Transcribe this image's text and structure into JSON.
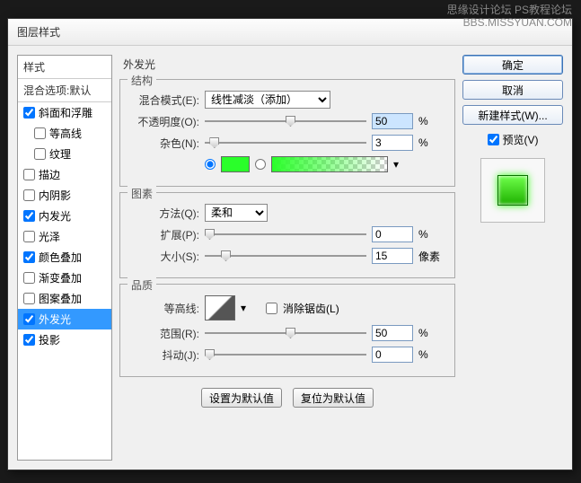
{
  "watermark": {
    "line1": "思缘设计论坛  PS教程论坛",
    "line2": "BBS.MISSYUAN.COM"
  },
  "dialog": {
    "title": "图层样式"
  },
  "styles": {
    "header": "样式",
    "blend": "混合选项:默认",
    "items": [
      {
        "label": "斜面和浮雕",
        "checked": true,
        "indent": false
      },
      {
        "label": "等高线",
        "checked": false,
        "indent": true
      },
      {
        "label": "纹理",
        "checked": false,
        "indent": true
      },
      {
        "label": "描边",
        "checked": false,
        "indent": false
      },
      {
        "label": "内阴影",
        "checked": false,
        "indent": false
      },
      {
        "label": "内发光",
        "checked": true,
        "indent": false
      },
      {
        "label": "光泽",
        "checked": false,
        "indent": false
      },
      {
        "label": "颜色叠加",
        "checked": true,
        "indent": false
      },
      {
        "label": "渐变叠加",
        "checked": false,
        "indent": false
      },
      {
        "label": "图案叠加",
        "checked": false,
        "indent": false
      },
      {
        "label": "外发光",
        "checked": true,
        "indent": false,
        "selected": true
      },
      {
        "label": "投影",
        "checked": true,
        "indent": false
      }
    ]
  },
  "panel": {
    "title": "外发光",
    "struct": {
      "legend": "结构",
      "blend_label": "混合模式(E):",
      "blend_value": "线性减淡（添加）",
      "opacity_label": "不透明度(O):",
      "opacity_value": "50",
      "opacity_unit": "%",
      "noise_label": "杂色(N):",
      "noise_value": "3",
      "noise_unit": "%",
      "color": "#2aff2a"
    },
    "elem": {
      "legend": "图素",
      "tech_label": "方法(Q):",
      "tech_value": "柔和",
      "spread_label": "扩展(P):",
      "spread_value": "0",
      "spread_unit": "%",
      "size_label": "大小(S):",
      "size_value": "15",
      "size_unit": "像素"
    },
    "qual": {
      "legend": "品质",
      "contour_label": "等高线:",
      "aa_label": "消除锯齿(L)",
      "range_label": "范围(R):",
      "range_value": "50",
      "range_unit": "%",
      "jitter_label": "抖动(J):",
      "jitter_value": "0",
      "jitter_unit": "%"
    },
    "footer": {
      "default": "设置为默认值",
      "reset": "复位为默认值"
    }
  },
  "right": {
    "ok": "确定",
    "cancel": "取消",
    "newstyle": "新建样式(W)...",
    "preview": "预览(V)"
  }
}
